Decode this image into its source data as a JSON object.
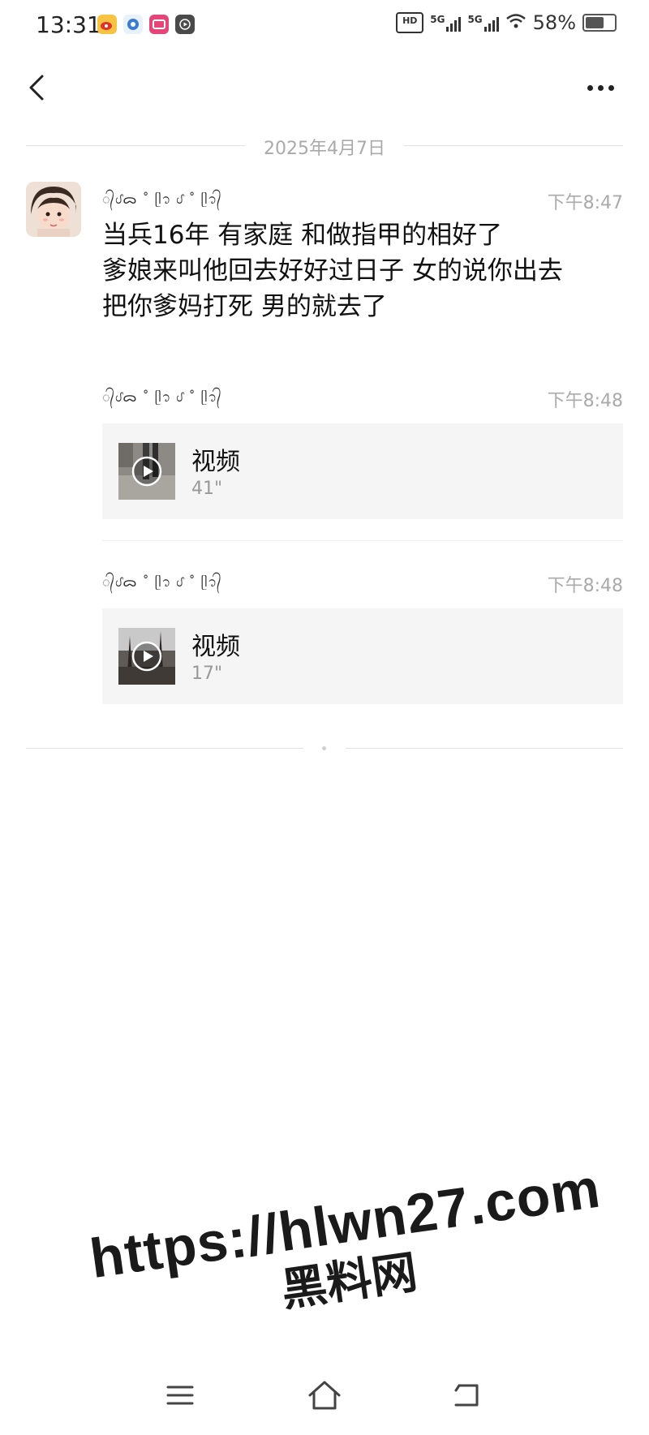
{
  "status_bar": {
    "time": "13:31",
    "app_icons": [
      "weibo-icon",
      "app-icon",
      "message-icon",
      "media-icon"
    ],
    "hd_label": "HD",
    "network_1": "5G",
    "network_2": "5G",
    "battery": "58%"
  },
  "chat": {
    "date": "2025年4月7日",
    "sender_name": "᭄ᦔᯅ ˚ ᥫ᭡ ᦔ ˚ ᥫ᭡᭄",
    "messages": [
      {
        "type": "text",
        "time": "下午8:47",
        "text": "当兵16年 有家庭 和做指甲的相好了\n爹娘来叫他回去好好过日子 女的说你出去\n把你爹妈打死  男的就去了"
      },
      {
        "type": "video",
        "time": "下午8:48",
        "label": "视频",
        "duration": "41\""
      },
      {
        "type": "video",
        "time": "下午8:48",
        "label": "视频",
        "duration": "17\""
      }
    ]
  },
  "watermark": {
    "url": "https://hlwn27.com",
    "name": "黑料网"
  },
  "colors": {
    "background": "#ffffff",
    "meta_text": "#aaaaaa",
    "card_background": "#f5f5f5"
  }
}
